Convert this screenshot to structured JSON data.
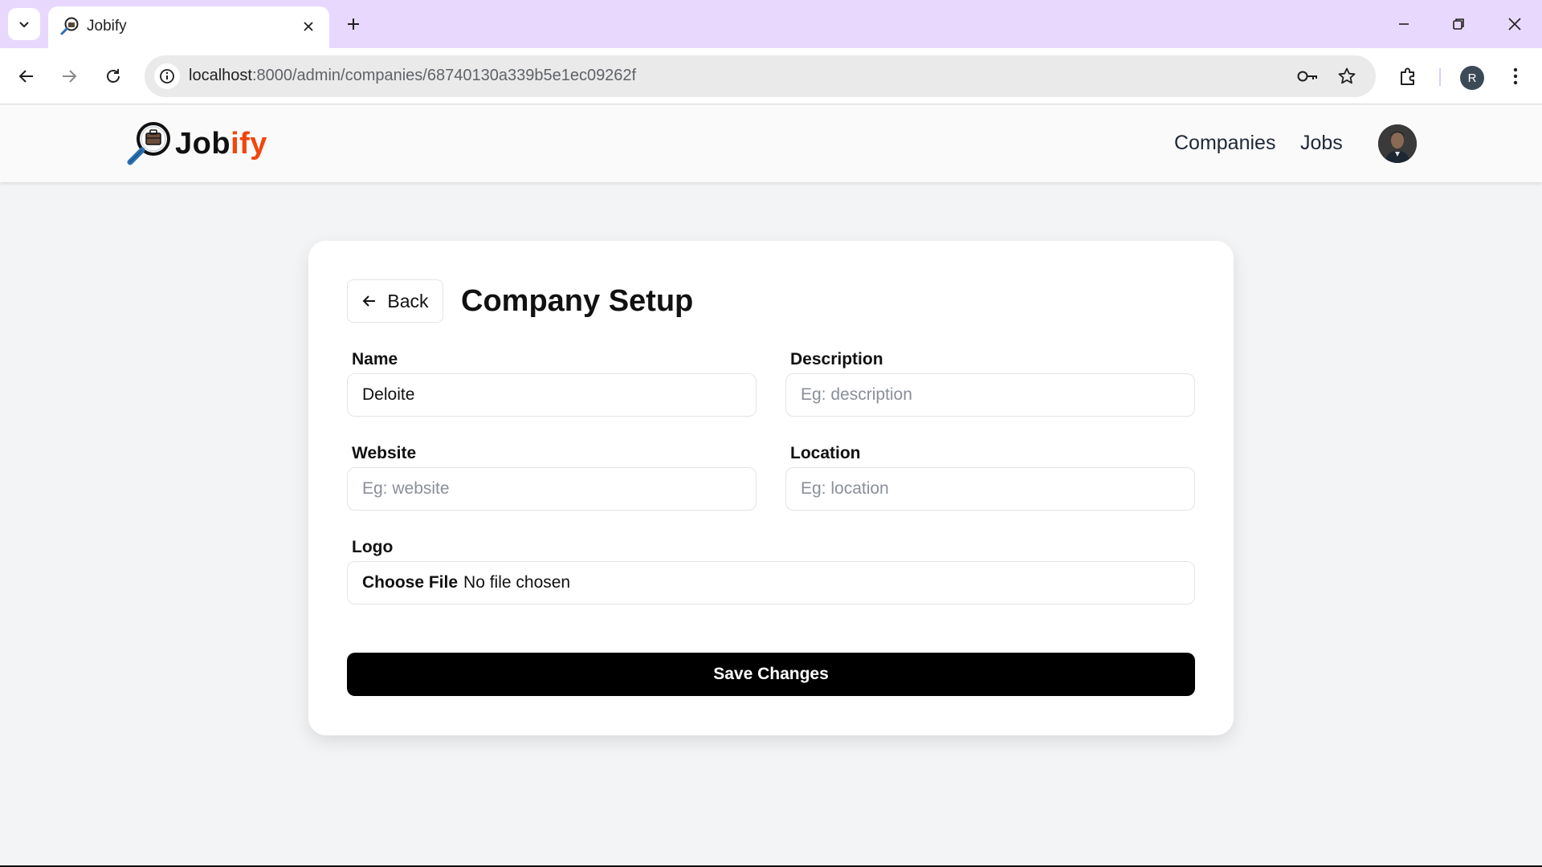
{
  "browser": {
    "tab": {
      "title": "Jobify"
    },
    "address_bar": {
      "host": "localhost",
      "path": ":8000/admin/companies/68740130a339b5e1ec09262f"
    },
    "profile_initial": "R"
  },
  "header": {
    "logo": {
      "part1": "Job",
      "part2": "ify"
    },
    "nav": [
      {
        "label": "Companies"
      },
      {
        "label": "Jobs"
      }
    ]
  },
  "card": {
    "back_label": "Back",
    "title": "Company Setup",
    "fields": {
      "name": {
        "label": "Name",
        "value": "Deloite",
        "placeholder": ""
      },
      "description": {
        "label": "Description",
        "value": "",
        "placeholder": "Eg: description"
      },
      "website": {
        "label": "Website",
        "value": "",
        "placeholder": "Eg: website"
      },
      "location": {
        "label": "Location",
        "value": "",
        "placeholder": "Eg: location"
      }
    },
    "logo": {
      "label": "Logo",
      "button": "Choose File",
      "status": "No file chosen"
    },
    "save_label": "Save Changes"
  },
  "colors": {
    "tab_strip": "#e9d8fd",
    "brand_orange": "#f2450c",
    "save_button": "#000000"
  }
}
